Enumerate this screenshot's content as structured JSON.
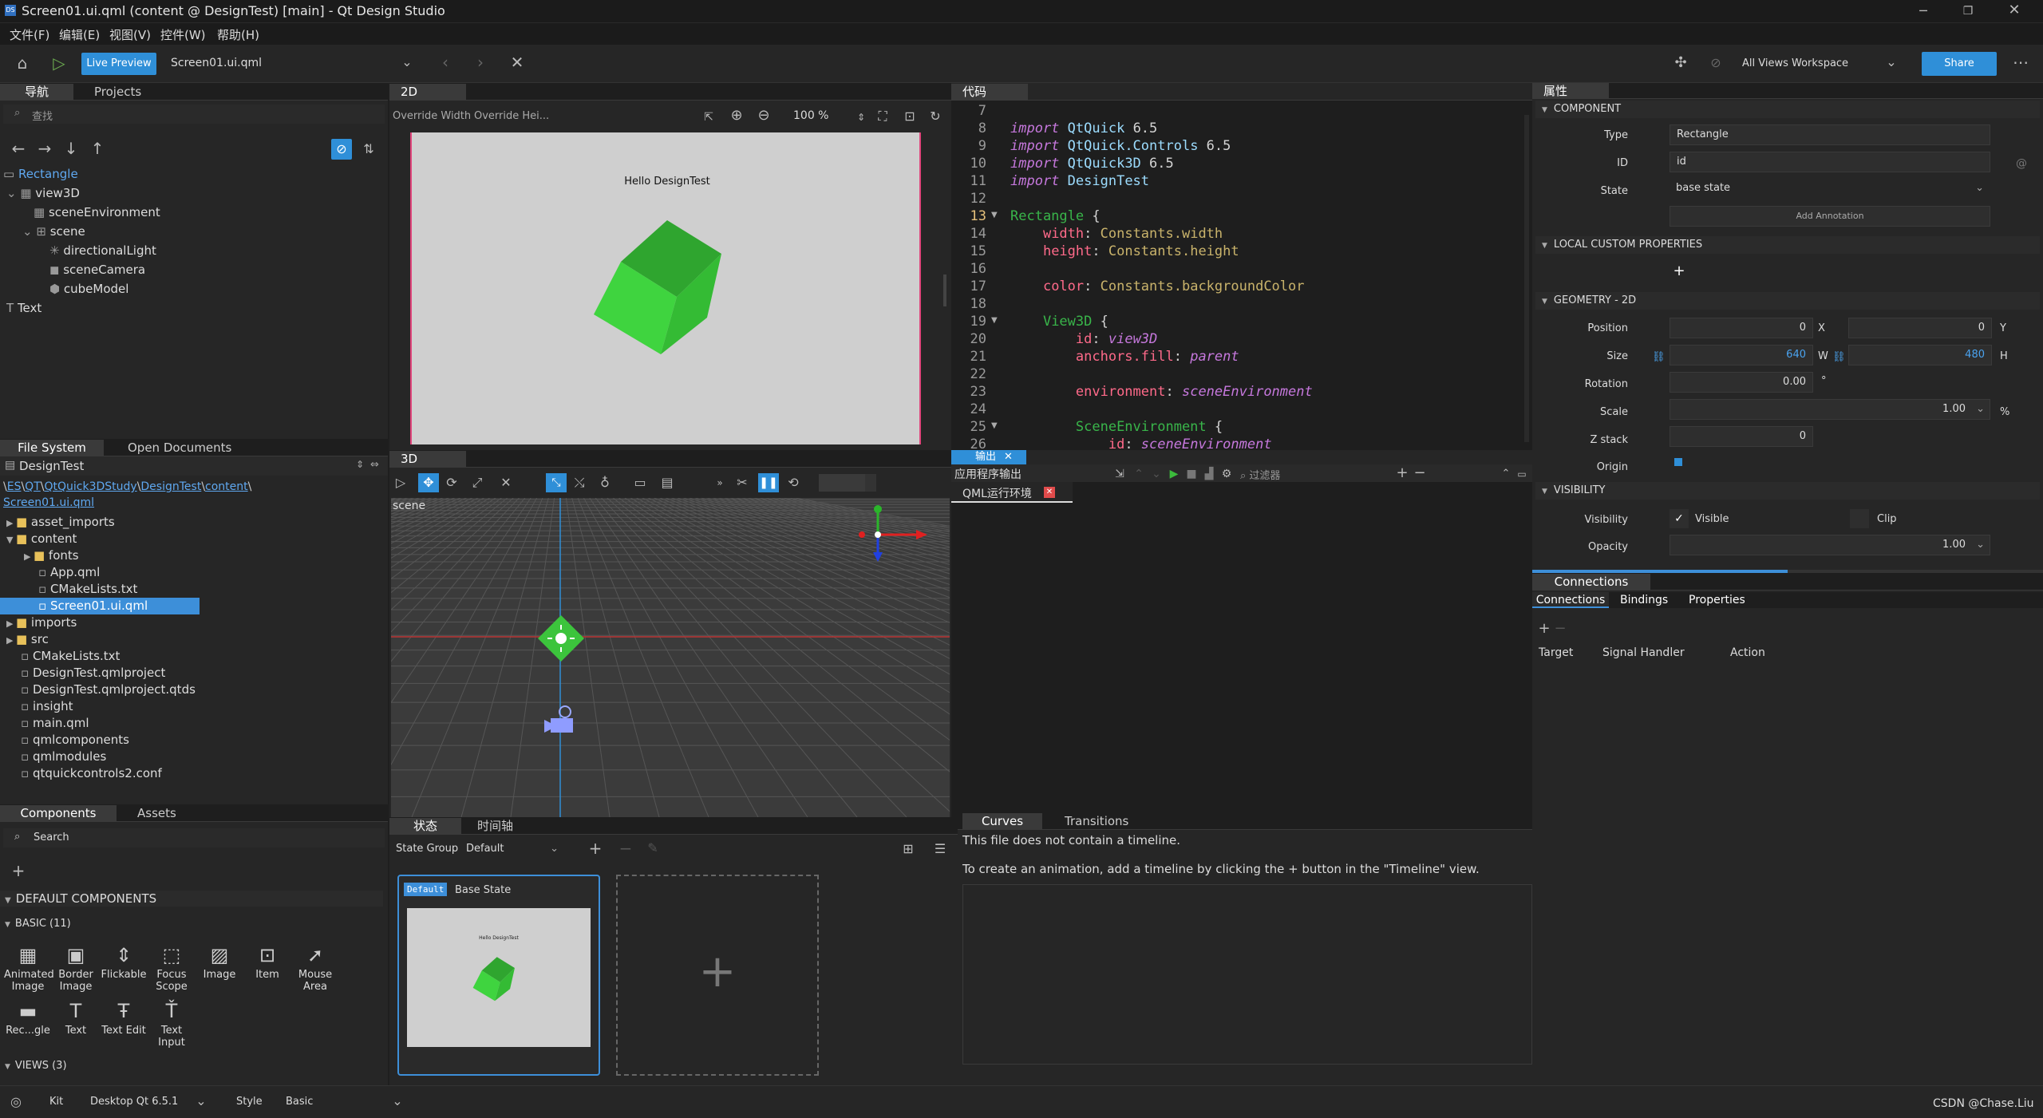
{
  "window": {
    "title": "Screen01.ui.qml (content @ DesignTest) [main] - Qt Design Studio",
    "app_icon": "DS"
  },
  "menu": [
    "文件(F)",
    "编辑(E)",
    "视图(V)",
    "控件(W)",
    "帮助(H)"
  ],
  "toolbar": {
    "live_preview": "Live Preview",
    "current_file": "Screen01.ui.qml",
    "workspace": "All Views Workspace",
    "share": "Share"
  },
  "navigator": {
    "tabs": [
      "导航",
      "Projects"
    ],
    "search_placeholder": "查找",
    "items": [
      {
        "label": "Rectangle",
        "icon": "rectangle-icon"
      },
      {
        "label": "view3D",
        "icon": "view3d-icon"
      },
      {
        "label": "sceneEnvironment",
        "icon": "environment-icon"
      },
      {
        "label": "scene",
        "icon": "node-icon"
      },
      {
        "label": "directionalLight",
        "icon": "light-icon"
      },
      {
        "label": "sceneCamera",
        "icon": "camera-icon"
      },
      {
        "label": "cubeModel",
        "icon": "model-icon"
      },
      {
        "label": "Text",
        "icon": "text-icon"
      }
    ]
  },
  "files": {
    "tabs": [
      "File System",
      "Open Documents"
    ],
    "root": "DesignTest",
    "breadcrumb": [
      "\\",
      "ES",
      "\\",
      "QT",
      "\\",
      "QtQuick3DStudy",
      "\\",
      "DesignTest",
      "\\",
      "content",
      "\\",
      "Screen01.ui.qml"
    ],
    "items": [
      {
        "label": "asset_imports",
        "type": "folder"
      },
      {
        "label": "content",
        "type": "folder"
      },
      {
        "label": "fonts",
        "type": "folder"
      },
      {
        "label": "App.qml",
        "type": "file"
      },
      {
        "label": "CMakeLists.txt",
        "type": "file"
      },
      {
        "label": "Screen01.ui.qml",
        "type": "file"
      },
      {
        "label": "imports",
        "type": "folder"
      },
      {
        "label": "src",
        "type": "folder"
      },
      {
        "label": "CMakeLists.txt",
        "type": "file"
      },
      {
        "label": "DesignTest.qmlproject",
        "type": "file"
      },
      {
        "label": "DesignTest.qmlproject.qtds",
        "type": "file"
      },
      {
        "label": "insight",
        "type": "file"
      },
      {
        "label": "main.qml",
        "type": "file"
      },
      {
        "label": "qmlcomponents",
        "type": "file"
      },
      {
        "label": "qmlmodules",
        "type": "file"
      },
      {
        "label": "qtquickcontrols2.conf",
        "type": "file"
      }
    ]
  },
  "components": {
    "tabs": [
      "Components",
      "Assets"
    ],
    "search": "Search",
    "section": "DEFAULT COMPONENTS",
    "basic": "BASIC (11)",
    "views": "VIEWS (3)",
    "items": [
      {
        "label": "Animated\nImage",
        "icon": "▦"
      },
      {
        "label": "Border\nImage",
        "icon": "▣"
      },
      {
        "label": "Flickable",
        "icon": "⇕"
      },
      {
        "label": "Focus\nScope",
        "icon": "⬚"
      },
      {
        "label": "Image",
        "icon": "▨"
      },
      {
        "label": "Item",
        "icon": "⊡"
      },
      {
        "label": "Mouse\nArea",
        "icon": "➚"
      },
      {
        "label": "Rec...gle",
        "icon": "▬"
      },
      {
        "label": "Text",
        "icon": "T"
      },
      {
        "label": "Text Edit",
        "icon": "Ŧ"
      },
      {
        "label": "Text\nInput",
        "icon": "Ť"
      }
    ]
  },
  "view2d": {
    "tab": "2D",
    "override_width": "Override Width",
    "override_height": "Override Hei...",
    "zoom": "100 %",
    "canvas_text": "Hello DesignTest"
  },
  "view3d": {
    "tab": "3D",
    "scene_label": "scene"
  },
  "code": {
    "tab": "代码",
    "lines": [
      {
        "n": "7",
        "t": ""
      },
      {
        "n": "8",
        "t": "import QtQuick 6.5"
      },
      {
        "n": "9",
        "t": "import QtQuick.Controls 6.5"
      },
      {
        "n": "10",
        "t": "import QtQuick3D 6.5"
      },
      {
        "n": "11",
        "t": "import DesignTest"
      },
      {
        "n": "12",
        "t": ""
      },
      {
        "n": "13",
        "t": "Rectangle {"
      },
      {
        "n": "14",
        "t": "    width: Constants.width"
      },
      {
        "n": "15",
        "t": "    height: Constants.height"
      },
      {
        "n": "16",
        "t": ""
      },
      {
        "n": "17",
        "t": "    color: Constants.backgroundColor"
      },
      {
        "n": "18",
        "t": ""
      },
      {
        "n": "19",
        "t": "    View3D {"
      },
      {
        "n": "20",
        "t": "        id: view3D"
      },
      {
        "n": "21",
        "t": "        anchors.fill: parent"
      },
      {
        "n": "22",
        "t": ""
      },
      {
        "n": "23",
        "t": "        environment: sceneEnvironment"
      },
      {
        "n": "24",
        "t": ""
      },
      {
        "n": "25",
        "t": "        SceneEnvironment {"
      },
      {
        "n": "26",
        "t": "            id: sceneEnvironment"
      }
    ]
  },
  "output": {
    "tab": "输出",
    "subtitle": "应用程序输出",
    "filter_placeholder": "过滤器",
    "run_tab": "QML运行环境"
  },
  "states": {
    "tabs": [
      "状态",
      "时间轴"
    ],
    "state_group_label": "State Group",
    "state_group": "Default",
    "default_badge": "Default",
    "base_state": "Base State",
    "thumb_text": "Hello DesignTest"
  },
  "timeline": {
    "tabs": [
      "Curves",
      "Transitions"
    ],
    "msg1": "This file does not contain a timeline.",
    "msg2": "To create an animation, add a timeline by clicking the + button in the \"Timeline\" view."
  },
  "properties": {
    "tab": "属性",
    "component": "COMPONENT",
    "type_label": "Type",
    "type_value": "Rectangle",
    "id_label": "ID",
    "id_value": "id",
    "state_label": "State",
    "state_value": "base state",
    "add_annotation": "Add Annotation",
    "local_custom": "LOCAL CUSTOM PROPERTIES",
    "geometry": "GEOMETRY - 2D",
    "position_label": "Position",
    "pos_x": "0",
    "x_label": "X",
    "pos_y": "0",
    "y_label": "Y",
    "size_label": "Size",
    "size_w": "640",
    "w_label": "W",
    "size_h": "480",
    "h_label": "H",
    "rotation_label": "Rotation",
    "rotation": "0.00",
    "deg": "°",
    "scale_label": "Scale",
    "scale": "1.00",
    "pct": "%",
    "zstack_label": "Z stack",
    "zstack": "0",
    "origin_label": "Origin",
    "visibility": "VISIBILITY",
    "visibility_label": "Visibility",
    "visible": "Visible",
    "clip": "Clip",
    "opacity_label": "Opacity",
    "opacity": "1.00"
  },
  "connections": {
    "title": "Connections",
    "tabs": [
      "Connections",
      "Bindings",
      "Properties"
    ],
    "cols": [
      "Target",
      "Signal Handler",
      "Action"
    ]
  },
  "statusbar": {
    "kit_label": "Kit",
    "kit": "Desktop Qt 6.5.1",
    "style_label": "Style",
    "style": "Basic",
    "watermark": "CSDN @Chase.Liu"
  },
  "colors": {
    "accent": "#2f8fd8",
    "selection": "#3d8fd9",
    "cube": "#3cc43c",
    "keyword": "#c678dd",
    "type": "#39b54a",
    "prop": "#ff6a8a",
    "ref": "#c9b36b"
  }
}
